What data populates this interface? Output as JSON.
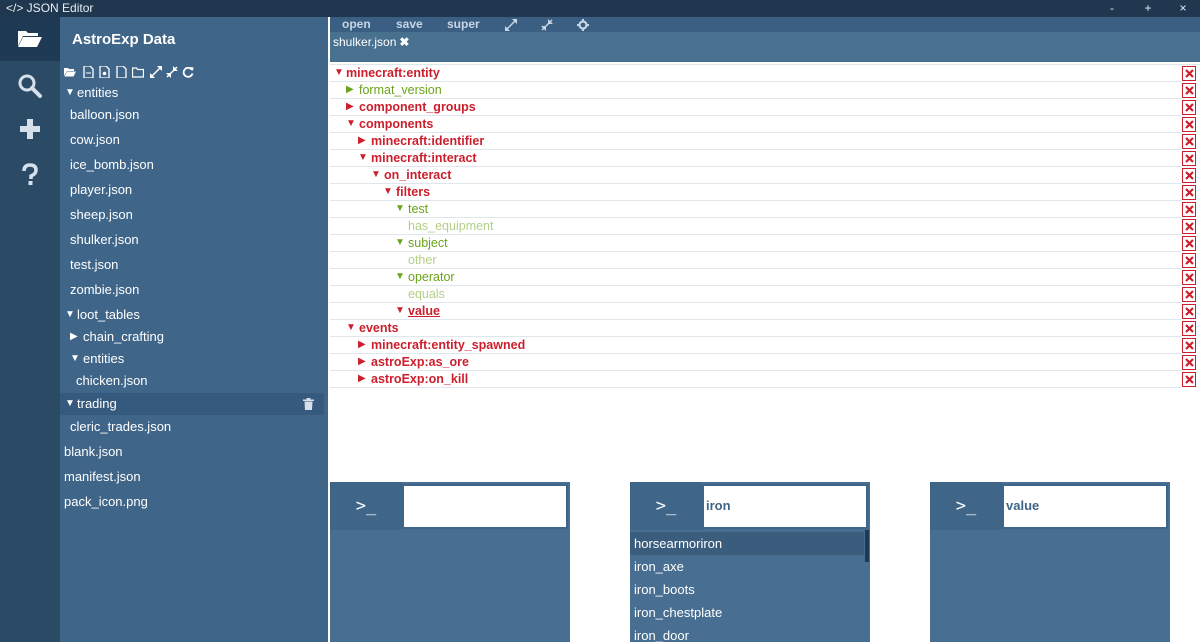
{
  "window": {
    "title": "</> JSON Editor",
    "minimize": "-",
    "maximize": "+",
    "close": "×"
  },
  "rail": {
    "icons": [
      "folder-open-icon",
      "search-icon",
      "plus-icon",
      "help-icon"
    ]
  },
  "sidebar": {
    "project_name": "AstroExp Data",
    "toolbar_icons": [
      "open-folder-icon",
      "new-file-icon",
      "new-json-icon",
      "new-doc-icon",
      "new-folder-icon",
      "expand-icon",
      "collapse-icon",
      "refresh-icon"
    ],
    "tree": [
      {
        "type": "folder",
        "label": "entities",
        "caret": "▼"
      },
      {
        "type": "file",
        "label": "balloon.json"
      },
      {
        "type": "file",
        "label": "cow.json"
      },
      {
        "type": "file",
        "label": "ice_bomb.json"
      },
      {
        "type": "file",
        "label": "player.json"
      },
      {
        "type": "file",
        "label": "sheep.json"
      },
      {
        "type": "file",
        "label": "shulker.json"
      },
      {
        "type": "file",
        "label": "test.json"
      },
      {
        "type": "file",
        "label": "zombie.json"
      },
      {
        "type": "folder",
        "label": "loot_tables",
        "caret": "▼"
      },
      {
        "type": "folder",
        "label": "chain_crafting",
        "caret": "▶"
      },
      {
        "type": "folder",
        "label": "entities",
        "caret": "▼"
      },
      {
        "type": "file",
        "label": "chicken.json"
      },
      {
        "type": "folder",
        "label": "trading",
        "caret": "▼"
      },
      {
        "type": "file",
        "label": "cleric_trades.json"
      },
      {
        "type": "file",
        "label": "blank.json"
      },
      {
        "type": "file",
        "label": "manifest.json"
      },
      {
        "type": "file",
        "label": "pack_icon.png"
      }
    ]
  },
  "menu": {
    "open": "open",
    "save": "save",
    "super": "super",
    "icons": [
      "expand-icon",
      "collapse-icon",
      "settings-icon"
    ]
  },
  "tabs": [
    {
      "label": "shulker.json",
      "close": "✖"
    }
  ],
  "editor": {
    "rows": [
      {
        "kind": "obj",
        "caret": "▼",
        "key": "minecraft:entity"
      },
      {
        "kind": "prop",
        "caret": "▶",
        "key": "format_version"
      },
      {
        "kind": "obj",
        "caret": "▶",
        "key": "component_groups"
      },
      {
        "kind": "obj",
        "caret": "▼",
        "key": "components"
      },
      {
        "kind": "obj",
        "caret": "▶",
        "key": "minecraft:identifier"
      },
      {
        "kind": "obj",
        "caret": "▼",
        "key": "minecraft:interact"
      },
      {
        "kind": "obj",
        "caret": "▼",
        "key": "on_interact"
      },
      {
        "kind": "obj",
        "caret": "▼",
        "key": "filters"
      },
      {
        "kind": "prop",
        "caret": "▼",
        "key": "test"
      },
      {
        "kind": "val",
        "caret": "",
        "key": "has_equipment"
      },
      {
        "kind": "prop",
        "caret": "▼",
        "key": "subject"
      },
      {
        "kind": "val",
        "caret": "",
        "key": "other"
      },
      {
        "kind": "prop",
        "caret": "▼",
        "key": "operator"
      },
      {
        "kind": "val",
        "caret": "",
        "key": "equals"
      },
      {
        "kind": "obj",
        "caret": "▼",
        "key": "value"
      },
      {
        "kind": "obj",
        "caret": "▼",
        "key": "events"
      },
      {
        "kind": "obj",
        "caret": "▶",
        "key": "minecraft:entity_spawned"
      },
      {
        "kind": "obj",
        "caret": "▶",
        "key": "astroExp:as_ore"
      },
      {
        "kind": "obj",
        "caret": "▶",
        "key": "astroExp:on_kill"
      }
    ]
  },
  "panels": [
    {
      "prompt": ">_",
      "value": "",
      "suggestions": []
    },
    {
      "prompt": ">_",
      "value": "iron",
      "suggestions": [
        "horsearmoriron",
        "iron_axe",
        "iron_boots",
        "iron_chestplate",
        "iron_door"
      ]
    },
    {
      "prompt": ">_",
      "value": "value",
      "suggestions": []
    }
  ]
}
